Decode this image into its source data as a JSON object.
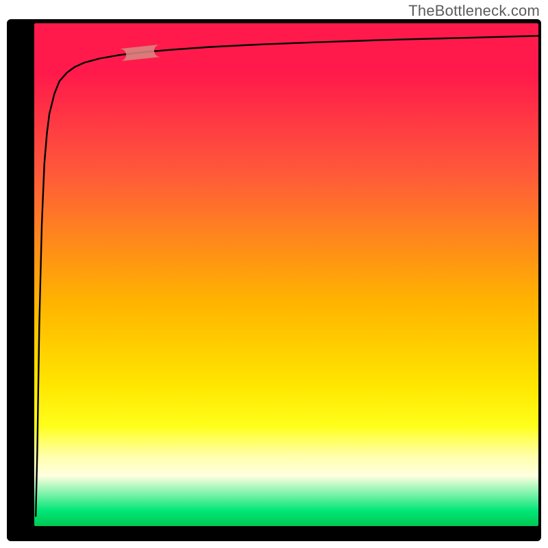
{
  "watermark": "TheBottleneck.com",
  "colors": {
    "frame": "#000000",
    "curve": "#000000",
    "highlight_fill": "#d88a82",
    "highlight_alpha": 0.85,
    "gradient_stops": [
      {
        "pos": 0.0,
        "hex": "#ff1a4b"
      },
      {
        "pos": 0.1,
        "hex": "#ff1a4b"
      },
      {
        "pos": 0.3,
        "hex": "#ff5a3a"
      },
      {
        "pos": 0.55,
        "hex": "#ffb200"
      },
      {
        "pos": 0.72,
        "hex": "#ffe600"
      },
      {
        "pos": 0.8,
        "hex": "#ffff1a"
      },
      {
        "pos": 0.86,
        "hex": "#ffffaa"
      },
      {
        "pos": 0.9,
        "hex": "#ffffe0"
      },
      {
        "pos": 0.97,
        "hex": "#00e676"
      },
      {
        "pos": 1.0,
        "hex": "#00c853"
      }
    ]
  },
  "chart_data": {
    "type": "line",
    "title": "",
    "xlabel": "",
    "ylabel": "",
    "xlim": [
      0,
      100
    ],
    "ylim": [
      0,
      100
    ],
    "grid": false,
    "legend": false,
    "series": [
      {
        "name": "curve",
        "x": [
          0.3,
          0.6,
          1.0,
          1.5,
          2.0,
          2.5,
          3.0,
          4.0,
          5.0,
          6.5,
          8.0,
          10.0,
          13.0,
          17.0,
          22.0,
          28.0,
          35.0,
          45.0,
          55.0,
          70.0,
          85.0,
          100.0
        ],
        "y": [
          2.0,
          15.0,
          40.0,
          60.0,
          72.0,
          78.0,
          82.0,
          86.0,
          88.5,
          90.2,
          91.3,
          92.2,
          93.0,
          93.7,
          94.3,
          94.8,
          95.3,
          95.8,
          96.2,
          96.7,
          97.1,
          97.5
        ]
      }
    ],
    "highlight_segment": {
      "series": "curve",
      "x_start": 17.0,
      "x_end": 25.0
    },
    "background_gradient_yaxis": [
      {
        "y": 100,
        "hex": "#ff1a4b"
      },
      {
        "y": 70,
        "hex": "#ff5a3a"
      },
      {
        "y": 45,
        "hex": "#ffb200"
      },
      {
        "y": 25,
        "hex": "#ffe600"
      },
      {
        "y": 12,
        "hex": "#ffffaa"
      },
      {
        "y": 3,
        "hex": "#00e676"
      },
      {
        "y": 0,
        "hex": "#00c853"
      }
    ]
  }
}
